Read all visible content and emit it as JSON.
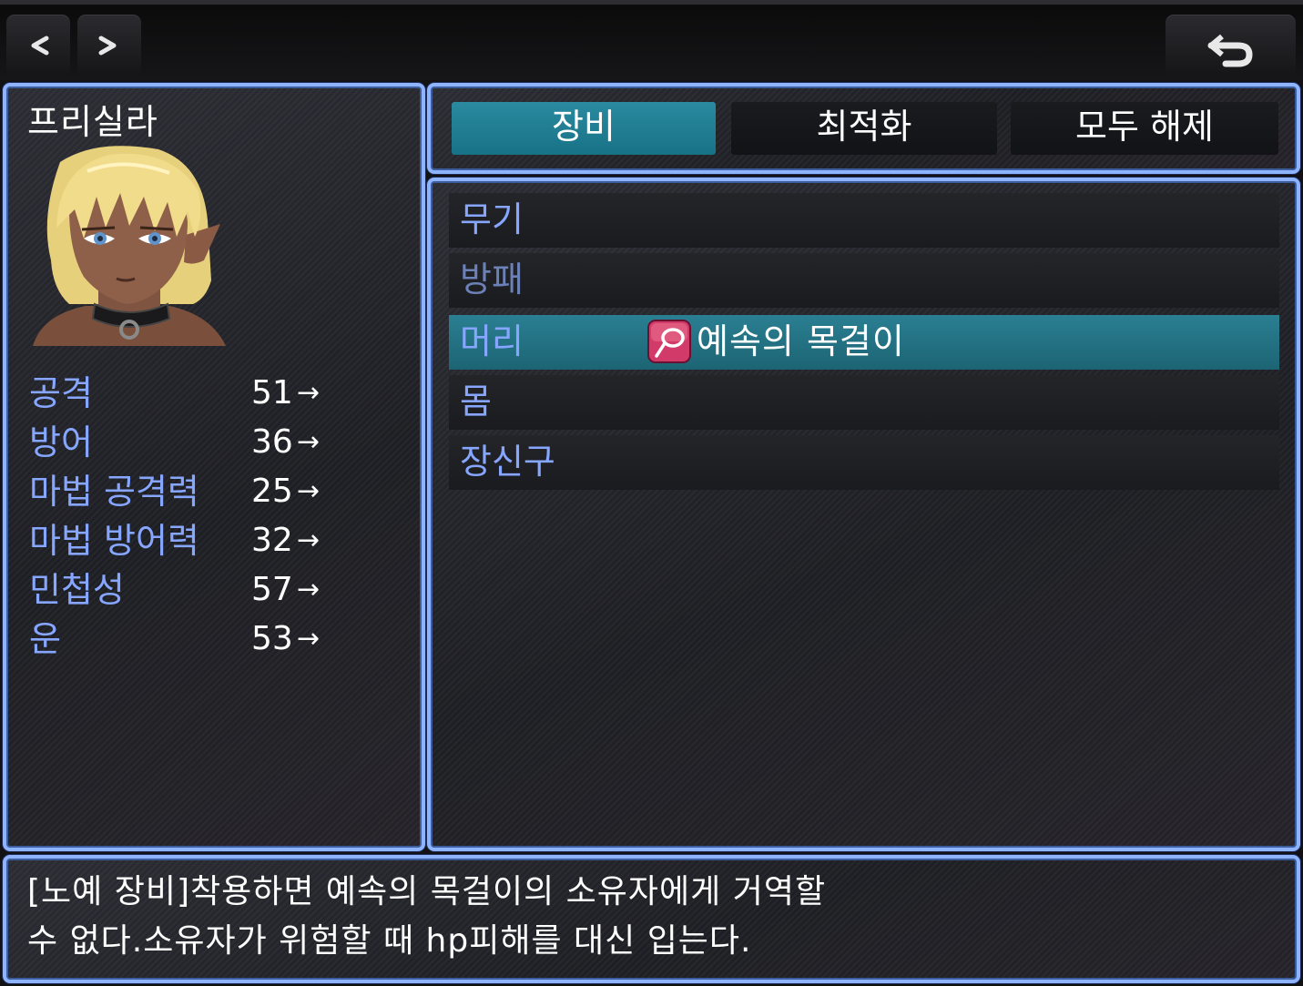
{
  "nav": {
    "prev_label": "<",
    "next_label": ">",
    "back_icon": "return-arrow-icon"
  },
  "actor": {
    "name": "프리실라",
    "portrait_icon": "character-portrait"
  },
  "stats": [
    {
      "label": "공격",
      "value": "51",
      "arrow": "→"
    },
    {
      "label": "방어",
      "value": "36",
      "arrow": "→"
    },
    {
      "label": "마법 공격력",
      "value": "25",
      "arrow": "→"
    },
    {
      "label": "마법 방어력",
      "value": "32",
      "arrow": "→"
    },
    {
      "label": "민첩성",
      "value": "57",
      "arrow": "→"
    },
    {
      "label": "운",
      "value": "53",
      "arrow": "→"
    }
  ],
  "commands": [
    {
      "label": "장비",
      "active": true
    },
    {
      "label": "최적화",
      "active": false
    },
    {
      "label": "모두 해제",
      "active": false
    }
  ],
  "slots": [
    {
      "label": "무기",
      "item": ""
    },
    {
      "label": "방패",
      "item": ""
    },
    {
      "label": "머리",
      "item": "예속의 목걸이",
      "item_icon": "collar-ring-icon"
    },
    {
      "label": "몸",
      "item": ""
    },
    {
      "label": "장신구",
      "item": ""
    }
  ],
  "help": {
    "line1": "[노예 장비]착용하면 예속의 목걸이의 소유자에게 거역할",
    "line2": "수 없다.소유자가 위험할 때 hp피해를 대신 입는다."
  },
  "colors": {
    "window_border": "#8fb4ff",
    "system_text": "#86a6ff",
    "selection": "#2a8aa0",
    "background": "#121214"
  }
}
